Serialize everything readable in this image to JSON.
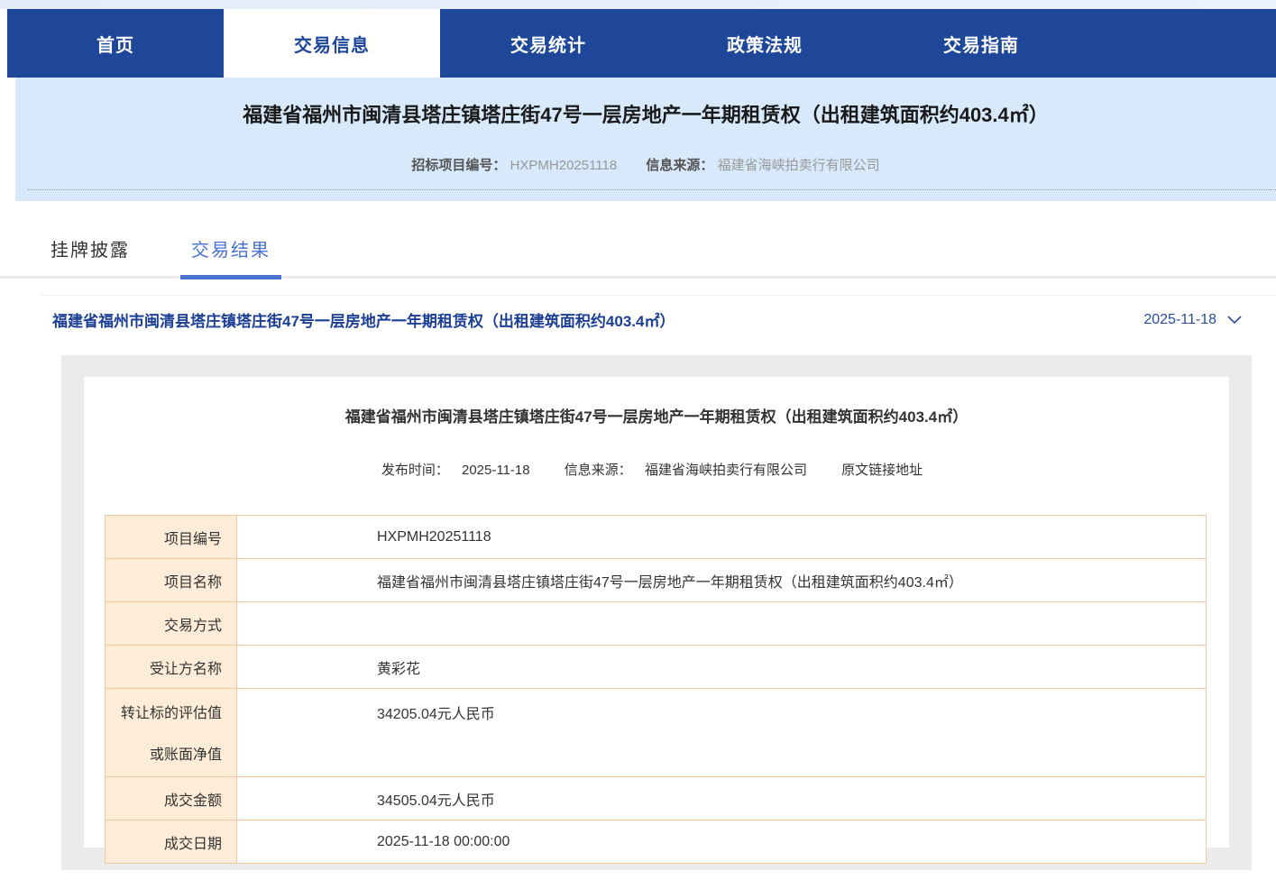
{
  "nav": {
    "items": [
      {
        "label": "首页",
        "active": false
      },
      {
        "label": "交易信息",
        "active": true
      },
      {
        "label": "交易统计",
        "active": false
      },
      {
        "label": "政策法规",
        "active": false
      },
      {
        "label": "交易指南",
        "active": false
      }
    ]
  },
  "header": {
    "title": "福建省福州市闽清县塔庄镇塔庄街47号一层房地产一年期租赁权（出租建筑面积约403.4㎡）",
    "project_no_label": "招标项目编号：",
    "project_no": "HXPMH20251118",
    "source_label": "信息来源：",
    "source": "福建省海峡拍卖行有限公司"
  },
  "tabs": {
    "listing": "挂牌披露",
    "result": "交易结果"
  },
  "result_row": {
    "link_title": "福建省福州市闽清县塔庄镇塔庄街47号一层房地产一年期租赁权（出租建筑面积约403.4㎡）",
    "date": "2025-11-18",
    "chevron_icon": "chevron-down"
  },
  "card": {
    "title": "福建省福州市闽清县塔庄镇塔庄街47号一层房地产一年期租赁权（出租建筑面积约403.4㎡）",
    "publish_label": "发布时间：",
    "publish_date": "2025-11-18",
    "source_label": "信息来源：",
    "source": "福建省海峡拍卖行有限公司",
    "orig_link": "原文链接地址"
  },
  "table": {
    "rows": [
      {
        "label": "项目编号",
        "value": "HXPMH20251118"
      },
      {
        "label": "项目名称",
        "value": "福建省福州市闽清县塔庄镇塔庄街47号一层房地产一年期租赁权（出租建筑面积约403.4㎡）"
      },
      {
        "label": "交易方式",
        "value": ""
      },
      {
        "label": "受让方名称",
        "value": "黄彩花"
      },
      {
        "label": "转让标的评估值",
        "label2": "或账面净值",
        "value": "34205.04元人民币"
      },
      {
        "label": "成交金额",
        "value": "34505.04元人民币"
      },
      {
        "label": "成交日期",
        "value": "2025-11-18 00:00:00"
      }
    ]
  },
  "colors": {
    "nav_blue": "#1e4799",
    "band_bg": "#d7e9fb",
    "tab_active": "#4a74cf",
    "link_blue": "#1b3f94",
    "panel_gray": "#ebebeb",
    "table_label_bg": "#fdecd7",
    "table_border": "#f2c89e"
  }
}
